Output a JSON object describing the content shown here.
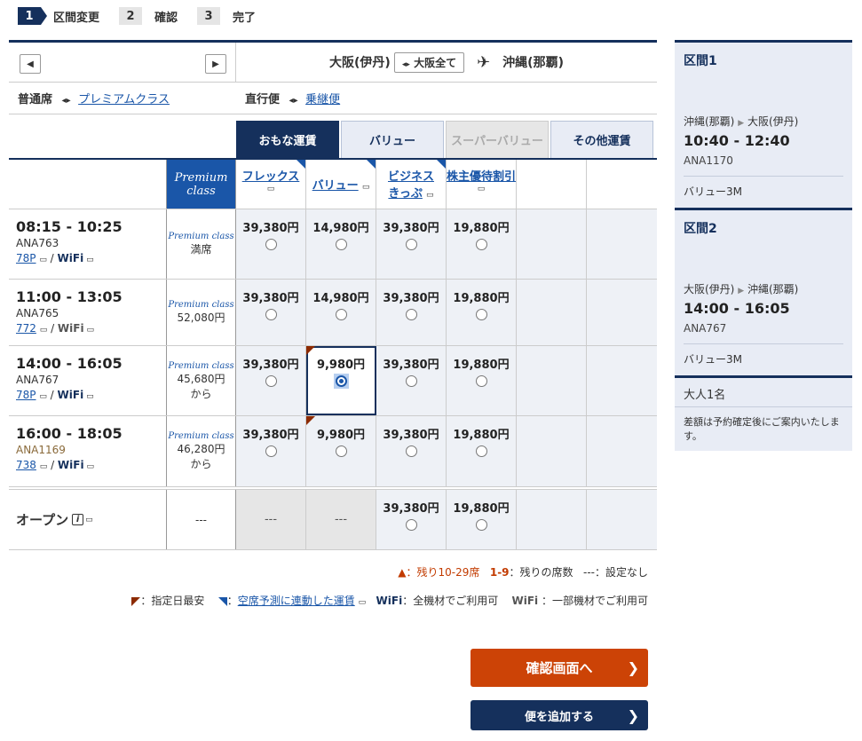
{
  "steps": [
    {
      "num": "1",
      "label": "区間変更"
    },
    {
      "num": "2",
      "label": "確認"
    },
    {
      "num": "3",
      "label": "完了"
    }
  ],
  "route": {
    "from": "大阪(伊丹)",
    "all_label": "大阪全て",
    "to": "沖縄(那覇)"
  },
  "seat": {
    "current": "普通席",
    "alt": "プレミアムクラス",
    "flight_type": "直行便",
    "flight_type_alt": "乗継便"
  },
  "tabs": [
    "おもな運賃",
    "バリュー",
    "スーパーバリュー",
    "その他運賃"
  ],
  "columns": {
    "premium": "Premium class",
    "flex": "フレックス",
    "value": "バリュー",
    "business": "ビジネス",
    "business2": "きっぷ",
    "shareholder": "株主優待割引"
  },
  "flights": [
    {
      "time": "08:15 - 10:25",
      "code": "ANA763",
      "aircraft": "78P",
      "wifi": "WiFi",
      "prem_logo": "Premium class",
      "prem": "満席",
      "prem2": "",
      "flex": "39,380円",
      "value": "14,980円",
      "biz": "39,380円",
      "sh": "19,880円"
    },
    {
      "time": "11:00 - 13:05",
      "code": "ANA765",
      "aircraft": "772",
      "wifi": "WiFi",
      "prem_logo": "Premium class",
      "prem": "52,080円",
      "prem2": "",
      "flex": "39,380円",
      "value": "14,980円",
      "biz": "39,380円",
      "sh": "19,880円"
    },
    {
      "time": "14:00 - 16:05",
      "code": "ANA767",
      "aircraft": "78P",
      "wifi": "WiFi",
      "prem_logo": "Premium class",
      "prem": "45,680円",
      "prem2": "から",
      "flex": "39,380円",
      "value": "9,980円",
      "biz": "39,380円",
      "sh": "19,880円"
    },
    {
      "time": "16:00 - 18:05",
      "code": "ANA1169",
      "aircraft": "738",
      "wifi": "WiFi",
      "prem_logo": "Premium class",
      "prem": "46,280円",
      "prem2": "から",
      "flex": "39,380円",
      "value": "9,980円",
      "biz": "39,380円",
      "sh": "19,880円"
    }
  ],
  "open": {
    "label": "オープン",
    "prem": "---",
    "flex": "---",
    "value": "---",
    "biz": "39,380円",
    "sh": "19,880円"
  },
  "legend": {
    "l1a": "▲：残り10-29席",
    "l1b": "1-9",
    "l1c": "：残りの席数",
    "l1d": "---：設定なし",
    "l2a": "：指定日最安",
    "l2b": "空席予測に連動した運賃",
    "l2c": "WiFi",
    "l2d": "：全機材でご利用可",
    "l2e": "WiFi",
    "l2f": "：一部機材でご利用可"
  },
  "side": {
    "s1_title": "区間1",
    "s1_route_from": "沖縄(那覇)",
    "s1_route_to": "大阪(伊丹)",
    "s1_time": "10:40 - 12:40",
    "s1_code": "ANA1170",
    "s1_fare": "バリュー3M",
    "s2_title": "区間2",
    "s2_route_from": "大阪(伊丹)",
    "s2_route_to": "沖縄(那覇)",
    "s2_time": "14:00 - 16:05",
    "s2_code": "ANA767",
    "s2_fare": "バリュー3M",
    "pax": "大人1名",
    "note": "差額は予約確定後にご案内いたします。"
  },
  "buttons": {
    "confirm": "確認画面へ",
    "add": "便を追加する"
  },
  "colors": {
    "navy": "#15305c",
    "accent_blue": "#1a56a8",
    "orange": "#cc4306"
  }
}
